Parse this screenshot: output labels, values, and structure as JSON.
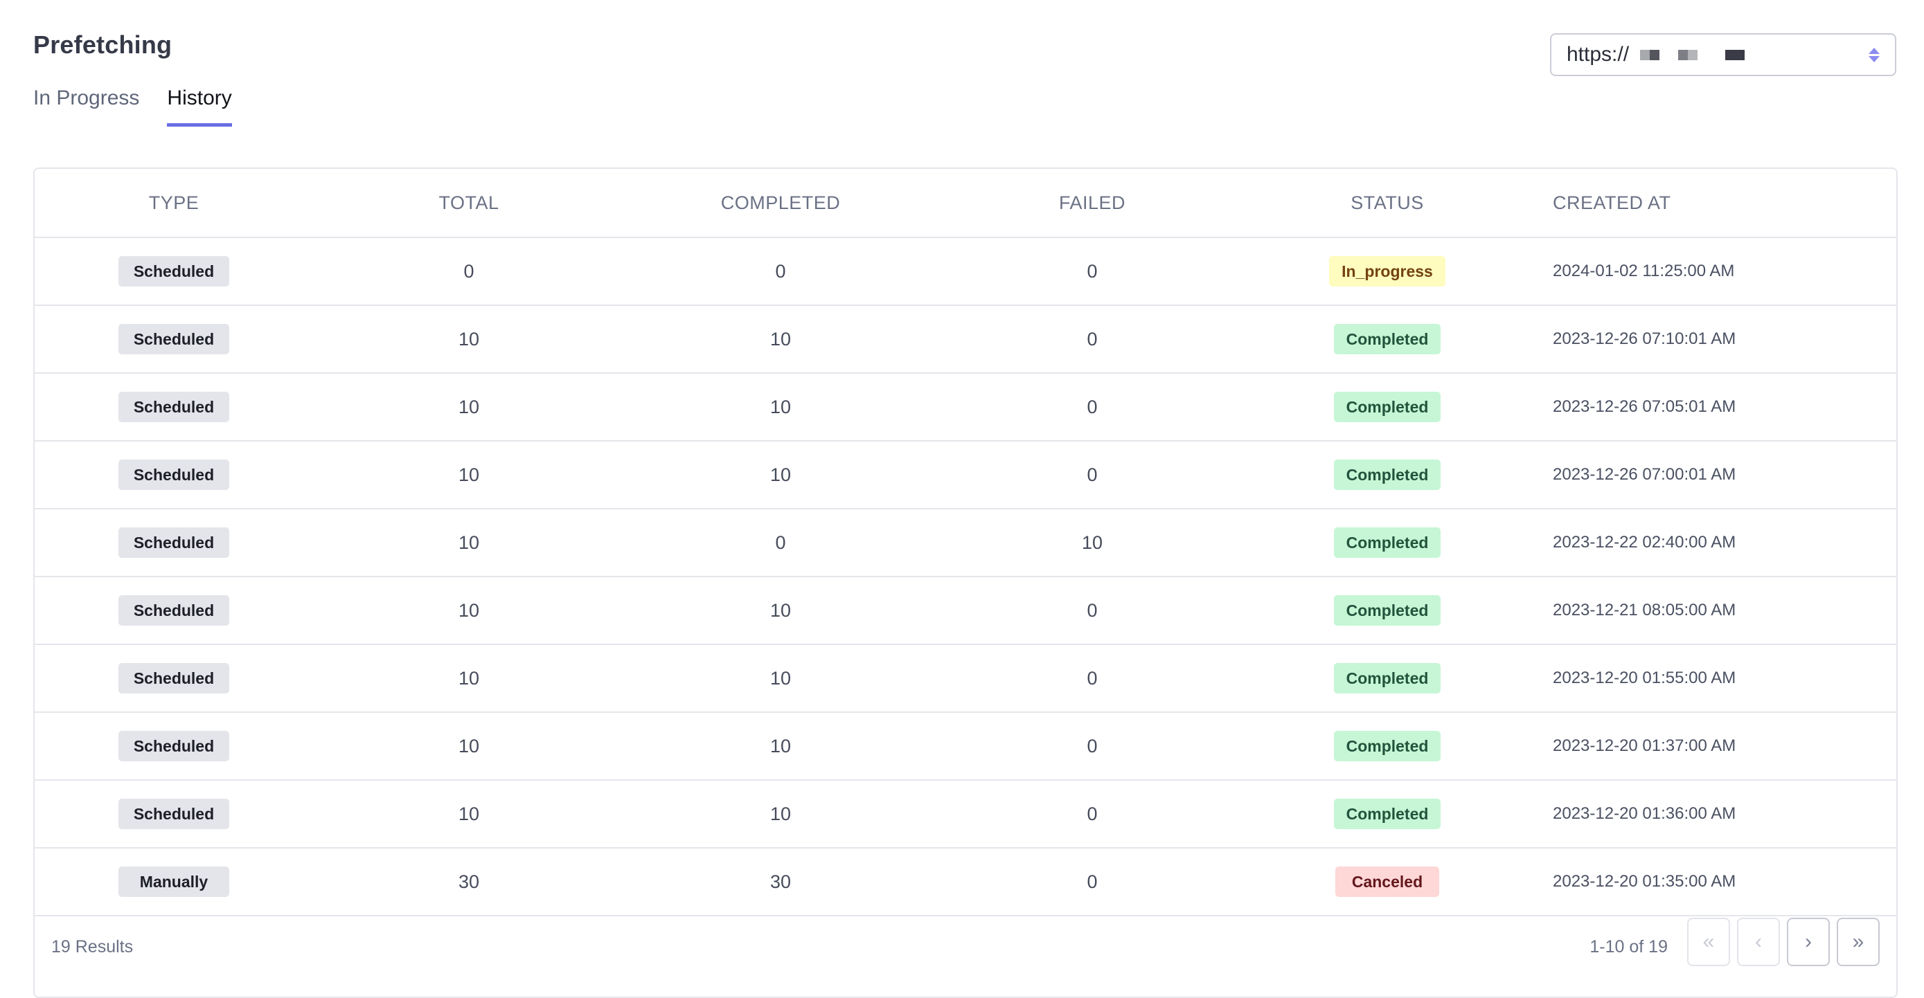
{
  "header": {
    "title": "Prefetching",
    "tabs": [
      {
        "label": "In Progress",
        "active": false
      },
      {
        "label": "History",
        "active": true
      }
    ],
    "source_select": {
      "value_prefix": "https://",
      "value_redacted": true
    }
  },
  "table": {
    "columns": [
      "TYPE",
      "TOTAL",
      "COMPLETED",
      "FAILED",
      "STATUS",
      "CREATED AT"
    ],
    "rows": [
      {
        "type": "Scheduled",
        "total": "0",
        "completed": "0",
        "failed": "0",
        "status": "In_progress",
        "created_at": "2024-01-02 11:25:00 AM"
      },
      {
        "type": "Scheduled",
        "total": "10",
        "completed": "10",
        "failed": "0",
        "status": "Completed",
        "created_at": "2023-12-26 07:10:01 AM"
      },
      {
        "type": "Scheduled",
        "total": "10",
        "completed": "10",
        "failed": "0",
        "status": "Completed",
        "created_at": "2023-12-26 07:05:01 AM"
      },
      {
        "type": "Scheduled",
        "total": "10",
        "completed": "10",
        "failed": "0",
        "status": "Completed",
        "created_at": "2023-12-26 07:00:01 AM"
      },
      {
        "type": "Scheduled",
        "total": "10",
        "completed": "0",
        "failed": "10",
        "status": "Completed",
        "created_at": "2023-12-22 02:40:00 AM"
      },
      {
        "type": "Scheduled",
        "total": "10",
        "completed": "10",
        "failed": "0",
        "status": "Completed",
        "created_at": "2023-12-21 08:05:00 AM"
      },
      {
        "type": "Scheduled",
        "total": "10",
        "completed": "10",
        "failed": "0",
        "status": "Completed",
        "created_at": "2023-12-20 01:55:00 AM"
      },
      {
        "type": "Scheduled",
        "total": "10",
        "completed": "10",
        "failed": "0",
        "status": "Completed",
        "created_at": "2023-12-20 01:37:00 AM"
      },
      {
        "type": "Scheduled",
        "total": "10",
        "completed": "10",
        "failed": "0",
        "status": "Completed",
        "created_at": "2023-12-20 01:36:00 AM"
      },
      {
        "type": "Manually",
        "total": "30",
        "completed": "30",
        "failed": "0",
        "status": "Canceled",
        "created_at": "2023-12-20 01:35:00 AM"
      }
    ]
  },
  "status_colors": {
    "In_progress": {
      "bg": "#fefcbf",
      "fg": "#744210"
    },
    "Completed": {
      "bg": "#c6f6d5",
      "fg": "#22543d"
    },
    "Canceled": {
      "bg": "#fed7d7",
      "fg": "#63171b"
    }
  },
  "accent_color": "#6a6ee3",
  "footer": {
    "results": "19 Results",
    "page_range": "1-10 of 19",
    "buttons": [
      {
        "icon": "first-page-icon",
        "glyph": "«",
        "disabled": true
      },
      {
        "icon": "previous-page-icon",
        "glyph": "‹",
        "disabled": true
      },
      {
        "icon": "next-page-icon",
        "glyph": "›",
        "disabled": false
      },
      {
        "icon": "last-page-icon",
        "glyph": "»",
        "disabled": false
      }
    ]
  }
}
